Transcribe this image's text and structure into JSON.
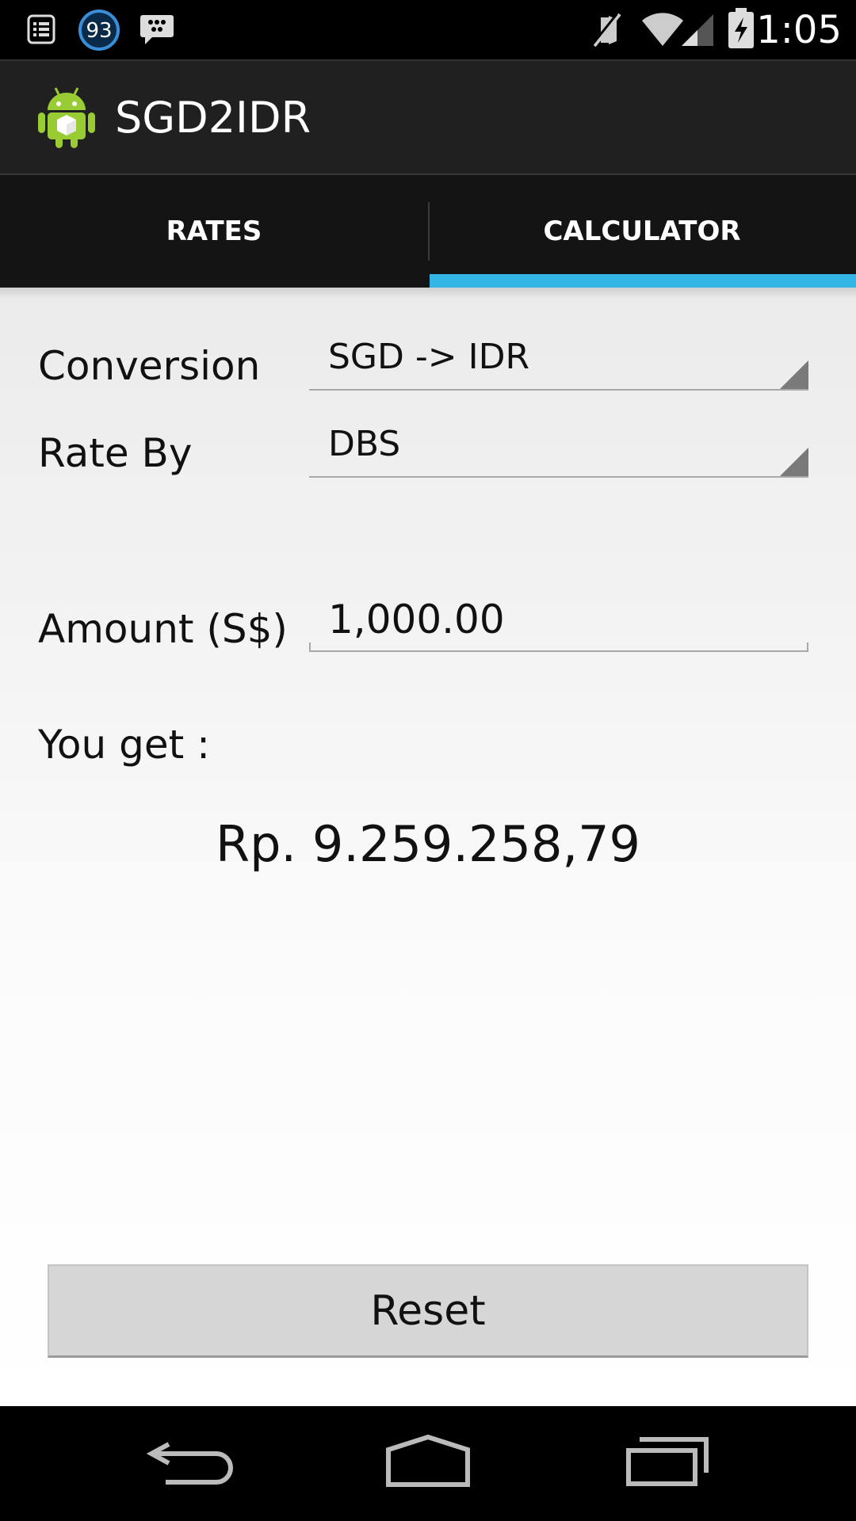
{
  "status_bar": {
    "time": "1:05",
    "notification_badge": "93",
    "icons": [
      "notification-list-icon",
      "battery-saver-badge-icon",
      "bbm-chat-icon",
      "mute-icon",
      "wifi-icon",
      "signal-icon",
      "battery-charging-icon"
    ]
  },
  "action_bar": {
    "title": "SGD2IDR",
    "icon": "android-app-icon"
  },
  "tabs": [
    {
      "label": "RATES",
      "selected": false
    },
    {
      "label": "CALCULATOR",
      "selected": true
    }
  ],
  "colors": {
    "accent": "#33b5e5",
    "action_bar": "#202020",
    "tab_bar": "#141414",
    "content_bg": "#f0f0f0",
    "button_bg": "#d6d6d6"
  },
  "form": {
    "conversion_label": "Conversion",
    "conversion_value": "SGD -> IDR",
    "rate_by_label": "Rate By",
    "rate_by_value": "DBS",
    "amount_label": "Amount (S$)",
    "amount_value": "1,000.00",
    "you_get_label": "You get :",
    "result_value": "Rp. 9.259.258,79"
  },
  "reset_button": {
    "label": "Reset"
  },
  "nav_bar": {
    "icons": [
      "back-icon",
      "home-icon",
      "recent-apps-icon"
    ]
  }
}
